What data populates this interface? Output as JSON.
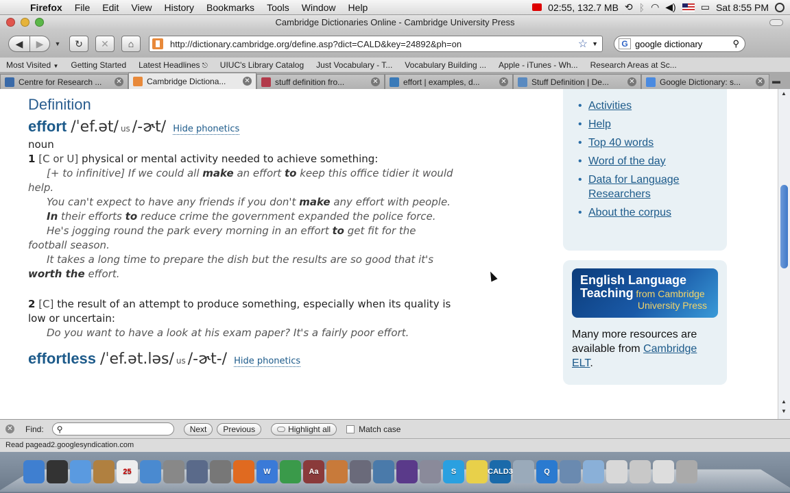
{
  "menubar": {
    "app": "Firefox",
    "items": [
      "File",
      "Edit",
      "View",
      "History",
      "Bookmarks",
      "Tools",
      "Window",
      "Help"
    ],
    "status_text": "02:55, 132.7 MB",
    "clock": "Sat 8:55 PM"
  },
  "window": {
    "title": "Cambridge Dictionaries Online - Cambridge University Press"
  },
  "navbar": {
    "url": "http://dictionary.cambridge.org/define.asp?dict=CALD&key=24892&ph=on",
    "search_query": "google dictionary",
    "search_engine_label": "G"
  },
  "bookmarks": [
    "Most Visited",
    "Getting Started",
    "Latest Headlines",
    "UIUC's Library Catalog",
    "Just Vocabulary - T...",
    "Vocabulary Building ...",
    "Apple - iTunes - Wh...",
    "Research Areas at Sc..."
  ],
  "tabs": [
    {
      "label": "Centre for Research ...",
      "color": "#3a6aa8",
      "active": false
    },
    {
      "label": "Cambridge Dictiona...",
      "color": "#e8893a",
      "active": true
    },
    {
      "label": "stuff definition fro...",
      "color": "#b23a4a",
      "active": false
    },
    {
      "label": "effort | examples, d...",
      "color": "#3a7ab8",
      "active": false
    },
    {
      "label": "Stuff Definition | De...",
      "color": "#5a8ac0",
      "active": false
    },
    {
      "label": "Google Dictionary: s...",
      "color": "#4a8ae0",
      "active": false
    }
  ],
  "entry": {
    "section_title": "Definition",
    "word1": {
      "headword": "effort",
      "phon_uk": "/ˈef.ət/",
      "us_label": "us",
      "phon_us": "/-ɚt/",
      "hide_label": "Hide phonetics",
      "pos": "noun",
      "sense1": {
        "num": "1",
        "grammar": "[C or U]",
        "definition": "physical or mental activity needed to achieve something:"
      },
      "ex1": {
        "pre_bracket": "[+ to infinitive]",
        "a": "If we could all",
        "b1": "make",
        "c": "an effort",
        "b2": "to",
        "d": "keep this office tidier it would help."
      },
      "ex2": {
        "a": "You can't expect to have any friends if you don't",
        "b": "make",
        "c": "any effort with people."
      },
      "ex3": {
        "b1": "In",
        "a": "their efforts",
        "b2": "to",
        "c": "reduce crime the government expanded the police force."
      },
      "ex4": {
        "a": "He's jogging round the park every morning in an effort",
        "b": "to",
        "c": "get fit for the football season."
      },
      "ex5": {
        "a": "It takes a long time to prepare the dish but the results are so good that it's",
        "b": "worth the",
        "c": "effort."
      },
      "sense2": {
        "num": "2",
        "grammar": "[C]",
        "definition": "the result of an attempt to produce something, especially when its quality is low or uncertain:"
      },
      "ex6": "Do you want to have a look at his exam paper? It's a fairly poor effort."
    },
    "word2": {
      "headword": "effortless",
      "phon_uk": "/ˈef.ət.ləs/",
      "us_label": "us",
      "phon_us": "/-ɚt-/",
      "hide_label": "Hide phonetics"
    }
  },
  "sidebar": {
    "links": [
      "Activities",
      "Help",
      "Top 40 words",
      "Word of the day",
      "Data for Language Researchers",
      "About the corpus"
    ],
    "banner": {
      "line1": "English Language",
      "line2": "Teaching",
      "line3": "from Cambridge",
      "line4": "University Press"
    },
    "resources_text": "Many more resources are available from",
    "resources_link": "Cambridge ELT",
    "resources_end": "."
  },
  "findbar": {
    "label": "Find:",
    "next": "Next",
    "previous": "Previous",
    "highlight": "Highlight all",
    "match_case": "Match case"
  },
  "status": "Read pagead2.googlesyndication.com",
  "dock": {
    "items": [
      {
        "name": "finder",
        "color": "#3f7fd0",
        "label": ""
      },
      {
        "name": "dashboard",
        "color": "#333333",
        "label": ""
      },
      {
        "name": "ichat",
        "color": "#5a9ae0",
        "label": ""
      },
      {
        "name": "address-book",
        "color": "#b08040",
        "label": ""
      },
      {
        "name": "ical",
        "color": "#eeeeee",
        "label": "25"
      },
      {
        "name": "itunes",
        "color": "#4a8ad0",
        "label": ""
      },
      {
        "name": "stickies-star",
        "color": "#888888",
        "label": ""
      },
      {
        "name": "spaces",
        "color": "#5a6a8a",
        "label": ""
      },
      {
        "name": "system-prefs",
        "color": "#777777",
        "label": ""
      },
      {
        "name": "firefox",
        "color": "#e06a20",
        "label": ""
      },
      {
        "name": "word",
        "color": "#3a7ad8",
        "label": "W"
      },
      {
        "name": "vocab-green",
        "color": "#3a9a4a",
        "label": ""
      },
      {
        "name": "dictionary",
        "color": "#8a3a3a",
        "label": "Aa"
      },
      {
        "name": "presentation",
        "color": "#c87a3a",
        "label": ""
      },
      {
        "name": "pen-tool",
        "color": "#6a6a7a",
        "label": ""
      },
      {
        "name": "chart-app",
        "color": "#4a7aaa",
        "label": ""
      },
      {
        "name": "movie",
        "color": "#5a3a8a",
        "label": ""
      },
      {
        "name": "scissors",
        "color": "#8a8a9a",
        "label": ""
      },
      {
        "name": "skype",
        "color": "#2aa0e0",
        "label": "S"
      },
      {
        "name": "notes",
        "color": "#e8d04a",
        "label": ""
      },
      {
        "name": "cald3",
        "color": "#1a6aaa",
        "label": "CALD3"
      },
      {
        "name": "photos",
        "color": "#9aaaba",
        "label": ""
      },
      {
        "name": "quicktime",
        "color": "#2a7ad0",
        "label": "Q"
      },
      {
        "name": "imovie",
        "color": "#6a8ab0",
        "label": ""
      },
      {
        "name": "folder",
        "color": "#8ab0d8",
        "label": ""
      },
      {
        "name": "documents",
        "color": "#d8d8d8",
        "label": ""
      },
      {
        "name": "downloads",
        "color": "#c8c8c8",
        "label": ""
      },
      {
        "name": "stack",
        "color": "#dddddd",
        "label": ""
      },
      {
        "name": "trash",
        "color": "#aaaaaa",
        "label": ""
      }
    ]
  }
}
